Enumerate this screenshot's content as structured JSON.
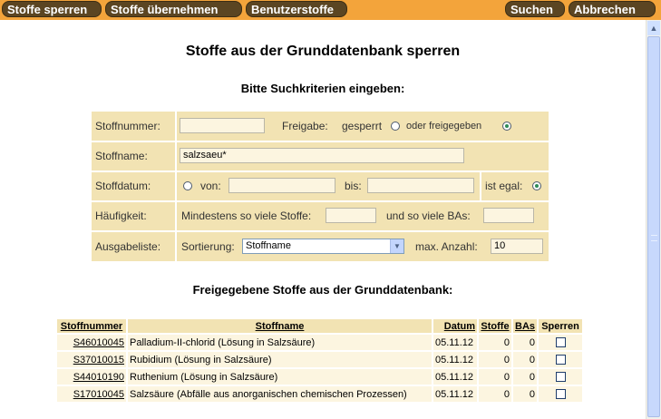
{
  "toolbar": {
    "btn_sperren": "Stoffe sperren",
    "btn_uebernehmen": "Stoffe übernehmen",
    "btn_benutzer": "Benutzerstoffe",
    "btn_suchen": "Suchen",
    "btn_abbrechen": "Abbrechen"
  },
  "page": {
    "title": "Stoffe aus der Grunddatenbank sperren",
    "subtitle": "Bitte Suchkriterien eingeben:",
    "results_title": "Freigegebene Stoffe aus der Grunddatenbank:"
  },
  "form": {
    "stoffnummer_label": "Stoffnummer:",
    "stoffnummer_value": "",
    "freigabe_label": "Freigabe:",
    "gesperrt_label": "gesperrt",
    "freigegeben_label": "oder freigegeben",
    "freigabe_selected": "freigegeben",
    "stoffname_label": "Stoffname:",
    "stoffname_value": "salzsaeu*",
    "stoffdatum_label": "Stoffdatum:",
    "von_label": "von:",
    "von_value": "",
    "bis_label": "bis:",
    "bis_value": "",
    "ist_egal_label": "ist egal:",
    "datum_selected": "ist egal",
    "haeufigkeit_label": "Häufigkeit:",
    "mindestens_label": "Mindestens so viele Stoffe:",
    "mindestens_value": "",
    "bas_label": "und so viele BAs:",
    "bas_value": "",
    "ausgabeliste_label": "Ausgabeliste:",
    "sortierung_label": "Sortierung:",
    "sortierung_value": "Stoffname",
    "max_anzahl_label": "max. Anzahl:",
    "max_anzahl_value": "10"
  },
  "results": {
    "headers": [
      "Stoffnummer",
      "Stoffname",
      "Datum",
      "Stoffe",
      "BAs",
      "Sperren"
    ],
    "rows": [
      {
        "nummer": "S46010045",
        "name": "Palladium-II-chlorid (Lösung in Salzsäure)",
        "datum": "05.11.12",
        "stoffe": "0",
        "bas": "0"
      },
      {
        "nummer": "S37010015",
        "name": "Rubidium (Lösung in Salzsäure)",
        "datum": "05.11.12",
        "stoffe": "0",
        "bas": "0"
      },
      {
        "nummer": "S44010190",
        "name": "Ruthenium (Lösung in Salzsäure)",
        "datum": "05.11.12",
        "stoffe": "0",
        "bas": "0"
      },
      {
        "nummer": "S17010045",
        "name": "Salzsäure (Abfälle aus anorganischen chemischen Prozessen)",
        "datum": "05.11.12",
        "stoffe": "0",
        "bas": "0"
      }
    ]
  },
  "colors": {
    "toolbar_bg": "#f3a43b",
    "button_bg": "#5b4522",
    "label_cell_bg": "#f2e3b3",
    "input_bg": "#fcf5e0"
  },
  "icons": {
    "scroll_up": "scroll-up-arrow-icon",
    "scroll_down": "scroll-down-arrow-icon",
    "dropdown": "chevron-down-icon"
  }
}
